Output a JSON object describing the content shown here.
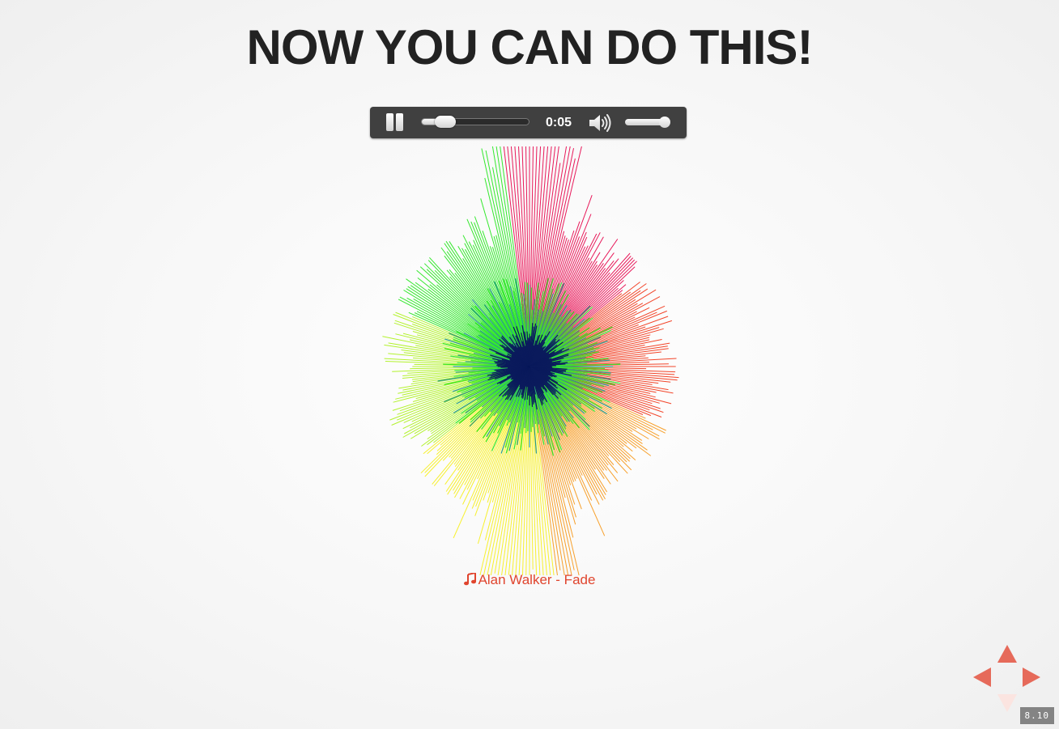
{
  "slide": {
    "title": "NOW YOU CAN DO THIS!",
    "number": "8.10"
  },
  "player": {
    "state": "playing",
    "pause_icon": "pause-icon",
    "current_time": "0:05",
    "progress_fraction": 0.22,
    "volume_icon": "volume-high-icon",
    "volume_fraction": 0.88
  },
  "song": {
    "icon": "music-note-icon",
    "title": "Alan Walker - Fade"
  },
  "navigation": {
    "up_enabled": true,
    "down_enabled": false,
    "left_enabled": true,
    "right_enabled": true,
    "arrow_color": "#e66a5a"
  },
  "visualizer": {
    "palette": [
      "#e8195a",
      "#f2452a",
      "#f7a02b",
      "#f7f02e",
      "#b3f22e",
      "#35e82e",
      "#2a9a8c",
      "#0a1a5c"
    ]
  }
}
